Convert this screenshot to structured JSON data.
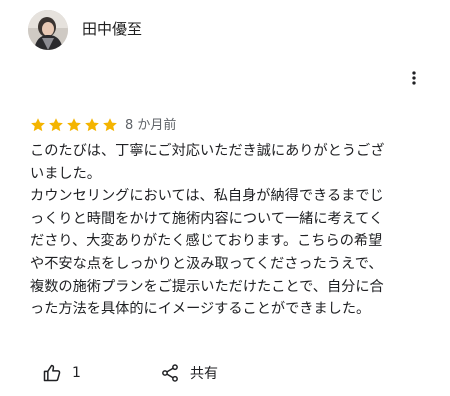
{
  "reviewer": {
    "name": "田中優至"
  },
  "review": {
    "rating": 5,
    "max_rating": 5,
    "star_color": "#f4b400",
    "date": "8 か月前",
    "lines": [
      "このたびは、丁寧にご対応いただき誠にありがとうござ",
      "いました。",
      "カウンセリングにおいては、私自身が納得できるまでじ",
      "っくりと時間をかけて施術内容について一緒に考えてく",
      "ださり、大変ありがたく感じております。こちらの希望",
      "や不安な点をしっかりと汲み取ってくださったうえで、",
      "複数の施術プランをご提示いただけたことで、自分に合",
      "った方法を具体的にイメージすることができました。"
    ]
  },
  "actions": {
    "like_count": "1",
    "share_label": "共有"
  },
  "icons": {
    "more": "more-vert-icon",
    "like": "thumb-up-icon",
    "share": "share-icon"
  }
}
